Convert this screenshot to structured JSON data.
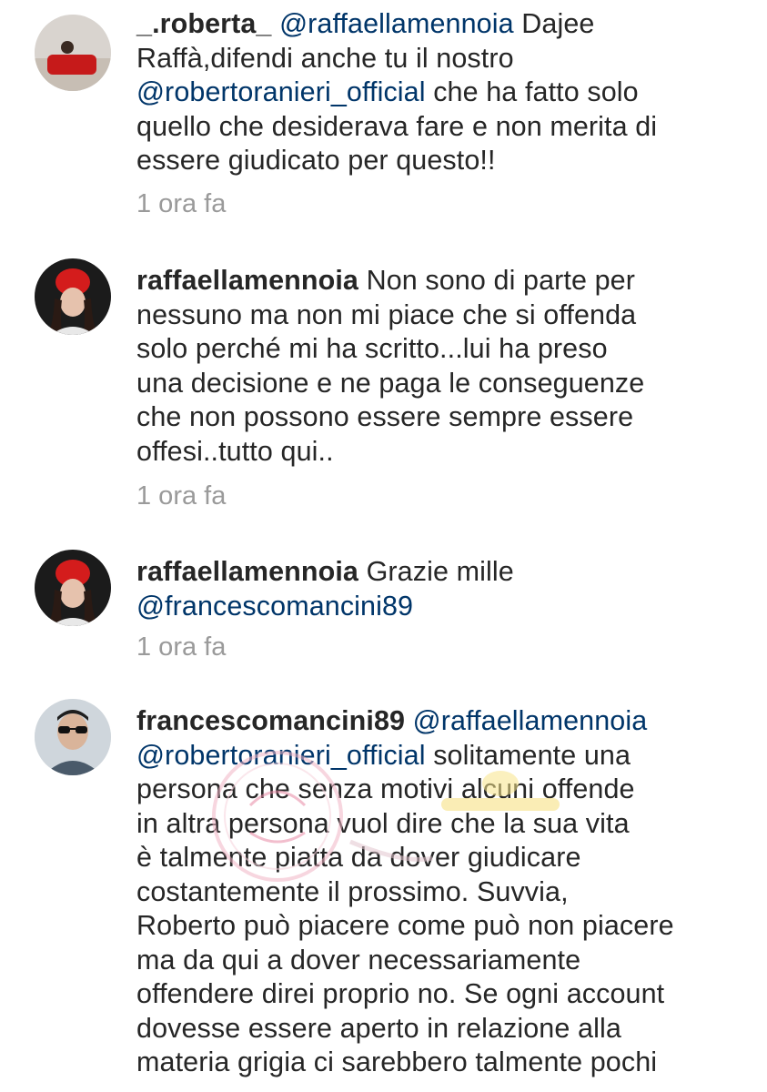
{
  "comments": [
    {
      "username": "_.roberta_",
      "lines": [
        [
          {
            "t": "u",
            "v": "_.roberta_"
          },
          {
            "t": "p",
            "v": " "
          },
          {
            "t": "m",
            "v": "@raffaellamennoia"
          },
          {
            "t": "p",
            "v": " Dajee"
          }
        ],
        [
          {
            "t": "p",
            "v": "Raffà,difendi anche tu il nostro"
          }
        ],
        [
          {
            "t": "m",
            "v": "@robertoranieri_official"
          },
          {
            "t": "p",
            "v": " che ha fatto solo"
          }
        ],
        [
          {
            "t": "p",
            "v": "quello che desiderava fare e non merita di"
          }
        ],
        [
          {
            "t": "p",
            "v": "essere giudicato per questo!!"
          }
        ]
      ],
      "time": "1 ora fa"
    },
    {
      "username": "raffaellamennoia",
      "lines": [
        [
          {
            "t": "u",
            "v": "raffaellamennoia"
          },
          {
            "t": "p",
            "v": " Non sono di parte per"
          }
        ],
        [
          {
            "t": "p",
            "v": "nessuno ma non mi piace che si offenda"
          }
        ],
        [
          {
            "t": "p",
            "v": "solo perché mi ha scritto...lui ha preso"
          }
        ],
        [
          {
            "t": "p",
            "v": "una decisione e ne paga le conseguenze"
          }
        ],
        [
          {
            "t": "p",
            "v": "che non possono essere sempre essere"
          }
        ],
        [
          {
            "t": "p",
            "v": "offesi..tutto qui.."
          }
        ]
      ],
      "time": "1 ora fa"
    },
    {
      "username": "raffaellamennoia",
      "lines": [
        [
          {
            "t": "u",
            "v": "raffaellamennoia"
          },
          {
            "t": "p",
            "v": " Grazie mille"
          }
        ],
        [
          {
            "t": "m",
            "v": "@francescomancini89"
          }
        ]
      ],
      "time": "1 ora fa"
    },
    {
      "username": "francescomancini89",
      "lines": [
        [
          {
            "t": "u",
            "v": "francescomancini89"
          },
          {
            "t": "p",
            "v": " "
          },
          {
            "t": "m",
            "v": "@raffaellamennoia"
          }
        ],
        [
          {
            "t": "m",
            "v": "@robertoranieri_official"
          },
          {
            "t": "p",
            "v": "  solitamente una"
          }
        ],
        [
          {
            "t": "p",
            "v": "persona che senza motivi alcuni offende"
          }
        ],
        [
          {
            "t": "p",
            "v": "in altra persona vuol dire che la sua vita"
          }
        ],
        [
          {
            "t": "p",
            "v": "è talmente piatta da dover giudicare"
          }
        ],
        [
          {
            "t": "p",
            "v": "costantemente il prossimo. Suvvia,"
          }
        ],
        [
          {
            "t": "p",
            "v": "Roberto può piacere come può non piacere"
          }
        ],
        [
          {
            "t": "p",
            "v": "ma da qui a dover necessariamente"
          }
        ],
        [
          {
            "t": "p",
            "v": "offendere direi proprio no. Se ogni account"
          }
        ],
        [
          {
            "t": "p",
            "v": "dovesse essere aperto in relazione alla"
          }
        ],
        [
          {
            "t": "p",
            "v": "materia grigia ci sarebbero talmente pochi"
          }
        ]
      ],
      "time": ""
    }
  ],
  "colors": {
    "text": "#262626",
    "mention": "#003569",
    "timestamp": "#9a9a9a"
  }
}
